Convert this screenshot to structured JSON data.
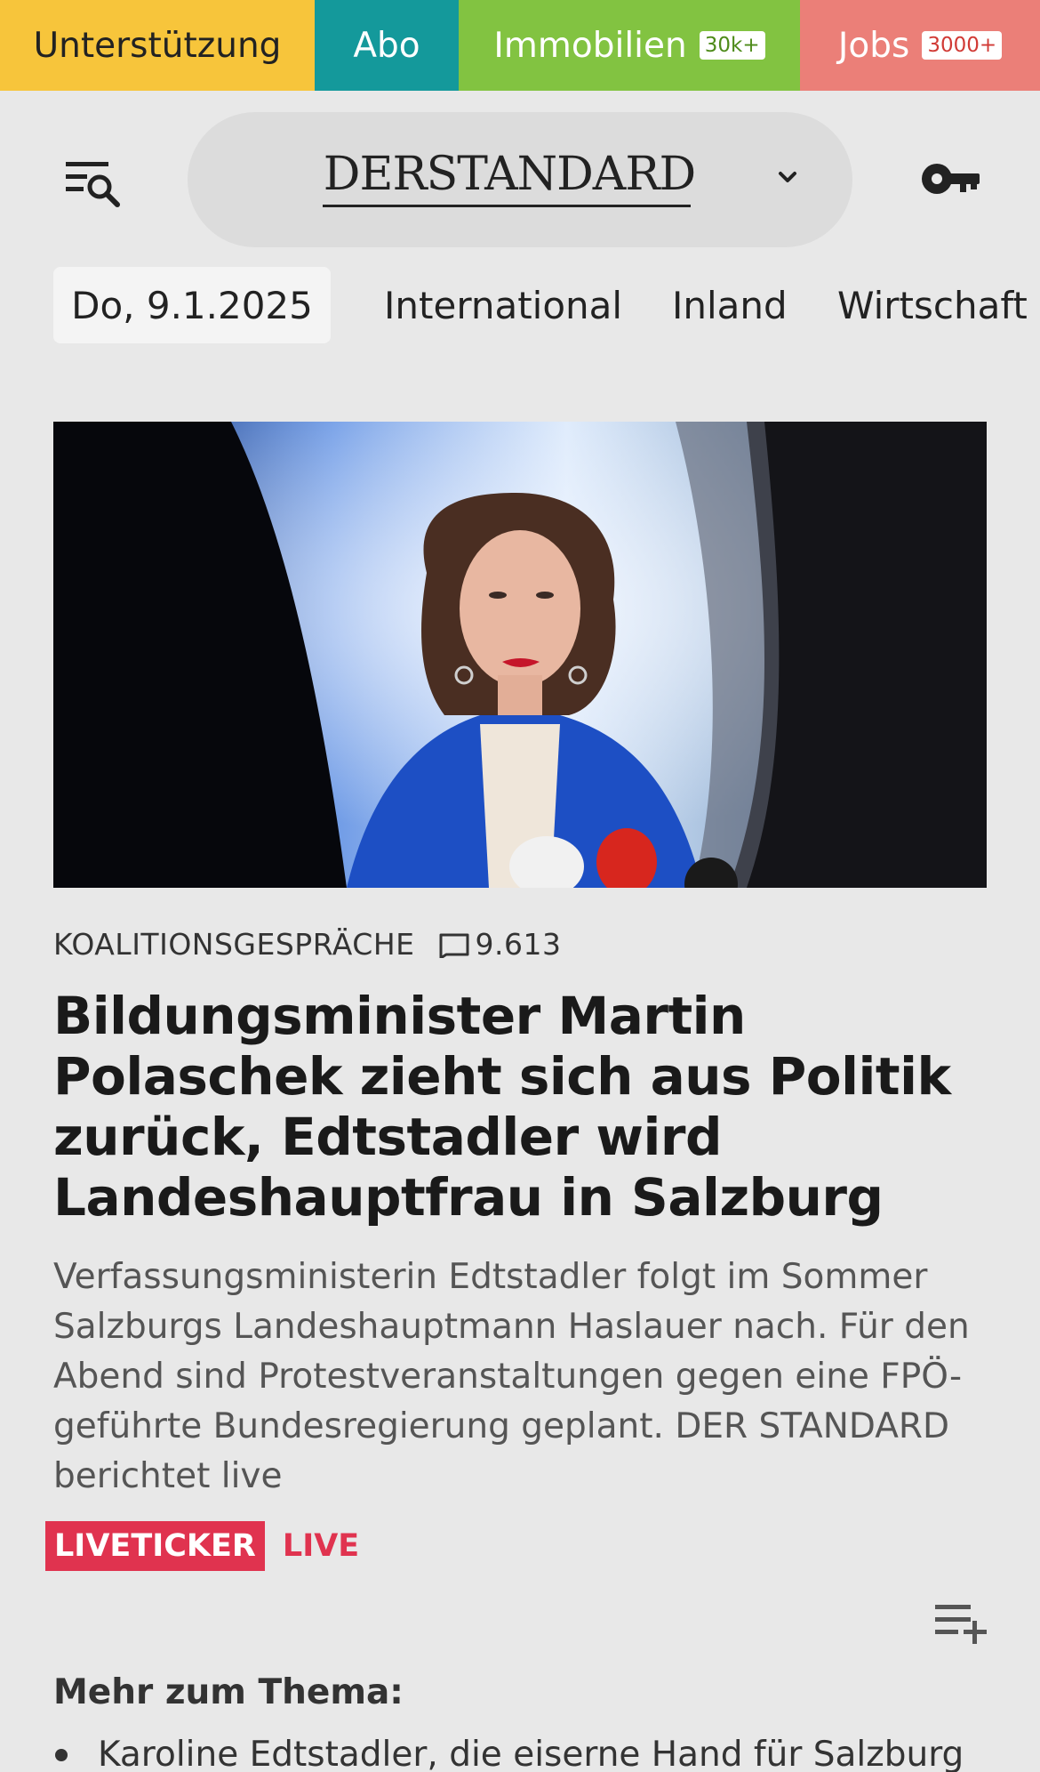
{
  "promo": {
    "support": "Unterstützung",
    "abo": "Abo",
    "immobilien": "Immobilien",
    "immobilien_badge": "30k+",
    "jobs": "Jobs",
    "jobs_badge": "3000+"
  },
  "header": {
    "logo": "DERSTANDARD"
  },
  "nav": {
    "date": "Do, 9.1.2025",
    "items": [
      "International",
      "Inland",
      "Wirtschaft"
    ]
  },
  "article": {
    "kicker": "KOALITIONSGESPRÄCHE",
    "comments": "9.613",
    "headline": "Bildungsminister Martin Polaschek zieht sich aus Politik zurück, Edtstadler wird Landeshauptfrau in Salzburg",
    "teaser": "Verfassungsministerin Edtstadler folgt im Sommer Salzburgs Landeshauptmann Haslauer nach. Für den Abend sind Protestveranstaltungen gegen eine FPÖ-geführte Bundesregierung geplant. DER STANDARD berichtet live",
    "liveticker": "LIVETICKER",
    "live": "LIVE"
  },
  "more": {
    "title": "Mehr zum Thema:",
    "items": [
      "Karoline Edtstadler, die eiserne Hand für Salzburg"
    ]
  },
  "colors": {
    "support": "#f7c53b",
    "abo": "#14999b",
    "immobilien": "#82c341",
    "jobs": "#eb7f78",
    "live": "#e0334f"
  }
}
